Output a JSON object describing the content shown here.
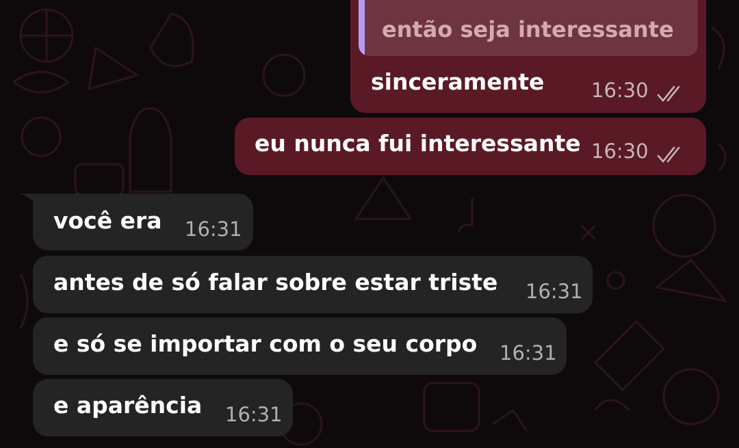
{
  "colors": {
    "background": "#0e0a0b",
    "outgoing_bubble": "#5a1a25",
    "incoming_bubble": "#242424",
    "quote_background": "#6e3540",
    "quote_accent": "#b49cf0"
  },
  "messages": [
    {
      "direction": "outgoing",
      "quoted_text": "então seja interessante",
      "text": "sinceramente",
      "time": "16:30",
      "status_icon": "double-check-icon"
    },
    {
      "direction": "outgoing",
      "text": "eu nunca fui interessante",
      "time": "16:30",
      "status_icon": "double-check-icon"
    },
    {
      "direction": "incoming",
      "text": "você era",
      "time": "16:31"
    },
    {
      "direction": "incoming",
      "text": "antes de só falar sobre estar triste",
      "time": "16:31"
    },
    {
      "direction": "incoming",
      "text": "e só se importar com o seu corpo",
      "time": "16:31"
    },
    {
      "direction": "incoming",
      "text": "e aparência",
      "time": "16:31"
    }
  ]
}
